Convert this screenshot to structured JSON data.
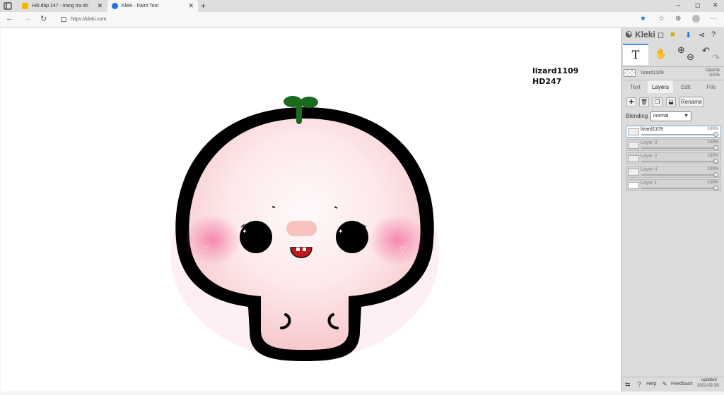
{
  "browser": {
    "tabs": [
      {
        "title": "Hỏi đáp 247 - trang tra lời",
        "favicon_color": "#f5b400",
        "active": false
      },
      {
        "title": "Kleki - Paint Tool",
        "favicon_color": "#1a73e8",
        "active": true
      }
    ],
    "url": "https://kleki.com",
    "new_tab": "+",
    "window_controls": [
      "–",
      "◻",
      "✕"
    ],
    "close_tab": "✕"
  },
  "canvas": {
    "text_lines": [
      "lizard1109",
      "HD247"
    ]
  },
  "app": {
    "logo": "Kleki",
    "brush_name": "lizard1109",
    "opacity_label": "Opacity",
    "opacity_value": "100%",
    "tool_selected": "T",
    "panel_tabs": [
      "Text",
      "Layers",
      "Edit",
      "File"
    ],
    "active_panel_tab": "Layers",
    "rename_label": "Rename",
    "blending_label": "Blending",
    "blending_value": "normal",
    "layers": [
      {
        "name": "lizard1109",
        "opacity": "100%",
        "selected": true
      },
      {
        "name": "Layer 3",
        "opacity": "100%",
        "selected": false
      },
      {
        "name": "Layer 2",
        "opacity": "100%",
        "selected": false
      },
      {
        "name": "Layer 4",
        "opacity": "100%",
        "selected": false
      },
      {
        "name": "Layer 1",
        "opacity": "100%",
        "selected": false
      }
    ],
    "footer": {
      "help": "Help",
      "feedback": "Feedback",
      "updated_label": "updated",
      "updated_date": "2022-02-20"
    }
  },
  "colors": {
    "accent": "#1a73e8",
    "panel_bg": "#dcdcdc",
    "character_pink": "#f7c9cc",
    "sprout_green": "#1b6b1f"
  }
}
